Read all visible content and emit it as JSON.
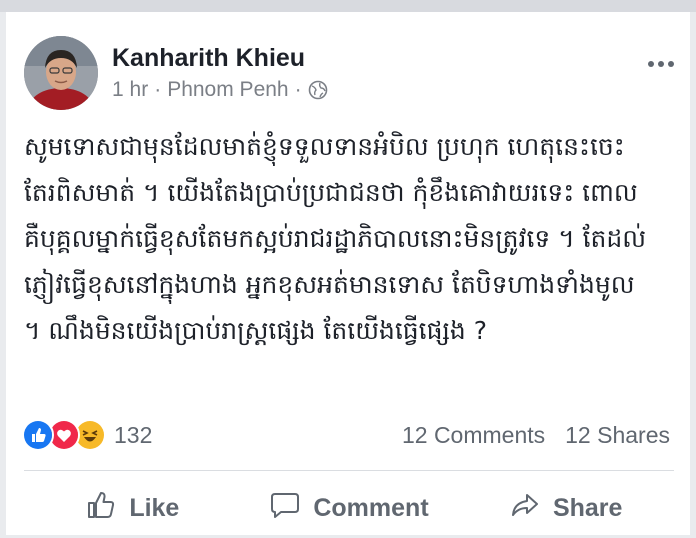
{
  "post": {
    "author": "Kanharith Khieu",
    "time": "1 hr",
    "location": "Phnom Penh",
    "separator": "·",
    "text_lines": [
      "សូមទោសជាមុនដែលមាត់ខ្ញុំទទួលទានអំបិល ប្រហុក ហេតុនេះចេះ",
      "តែរពិសមាត់ ។ យើងតែងប្រាប់ប្រជាជនថា កុំខឹងគោវាយរទេះ ពោល",
      "គឺបុគ្គលម្នាក់ធ្វើខុសតែមកស្អប់រាជរដ្ឋាភិបាលនោះមិនត្រូវទេ ។ តែដល់",
      "ភ្ញៀវធ្វើខុសនៅក្នុងហាង អ្នកខុសអត់មានទោស តែបិទហាងទាំងមូល",
      "។ ណឹងមិនយើងប្រាប់រាស្ត្រផ្សេង តែយើងធ្វើផ្សេង ?"
    ]
  },
  "stats": {
    "reaction_count": "132",
    "comments": "12 Comments",
    "shares": "12 Shares"
  },
  "reactions": [
    "like-icon",
    "love-icon",
    "haha-icon"
  ],
  "actions": {
    "like": "Like",
    "comment": "Comment",
    "share": "Share"
  },
  "colors": {
    "like_blue": "#1877f2",
    "love_red": "#f0284a",
    "haha_yellow": "#f7b928",
    "muted_text": "#606770"
  }
}
